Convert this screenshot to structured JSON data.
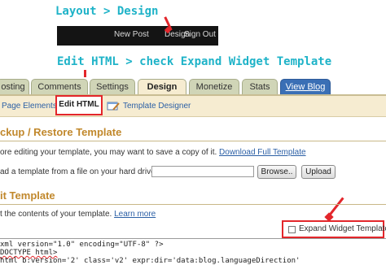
{
  "annotations": {
    "step1": "Layout > Design",
    "step2": "Edit HTML > check Expand Widget Template"
  },
  "top_nav": {
    "items": [
      "New Post",
      "Design",
      "Sign Out"
    ]
  },
  "tabs": [
    {
      "label": "osting"
    },
    {
      "label": "Comments"
    },
    {
      "label": "Settings"
    },
    {
      "label": "Design",
      "active": true
    },
    {
      "label": "Monetize"
    },
    {
      "label": "Stats"
    },
    {
      "label": "View Blog"
    }
  ],
  "subtabs": {
    "page_elements": "Page Elements",
    "edit_html": "Edit HTML",
    "template_designer": "Template Designer"
  },
  "backup": {
    "heading": "ckup / Restore Template",
    "intro": "ore editing your template, you may want to save a copy of it.",
    "download_link": "Download Full Template",
    "upload_prompt": "ad a template from a file on your hard drive:",
    "browse_label": "Browse..",
    "upload_label": "Upload"
  },
  "edit": {
    "heading": "it Template",
    "intro": "t the contents of your template.",
    "learn_more": "Learn more",
    "expand_label": "Expand Widget Templates",
    "expand_checked": false
  },
  "code": {
    "line1": "xml version=\"1.0\" encoding=\"UTF-8\" ?>",
    "line2": "DOCTYPE html>",
    "line3": "html b:version='2' class='v2' expr:dir='data:blog.languageDirection'"
  },
  "colors": {
    "annotation": "#1fb3c8",
    "highlight": "#e3262b",
    "heading": "#c1882c",
    "link": "#2b5fa5"
  }
}
